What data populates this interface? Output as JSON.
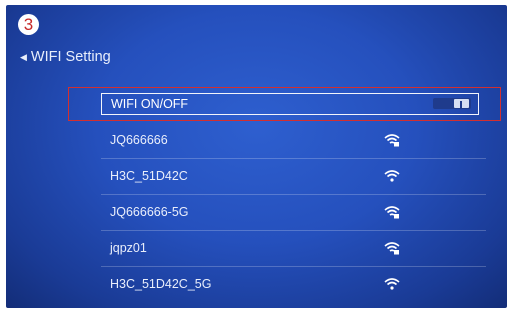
{
  "step_number": "3",
  "header": {
    "back_label": "WIFI Setting"
  },
  "wifi_toggle": {
    "label": "WIFI ON/OFF",
    "state": "on"
  },
  "networks": [
    {
      "ssid": "JQ666666",
      "secured": true
    },
    {
      "ssid": "H3C_51D42C",
      "secured": false
    },
    {
      "ssid": "JQ666666-5G",
      "secured": true
    },
    {
      "ssid": "jqpz01",
      "secured": true
    },
    {
      "ssid": "H3C_51D42C_5G",
      "secured": false
    }
  ],
  "colors": {
    "highlight": "#d32f2f",
    "background": "#2550bd"
  }
}
